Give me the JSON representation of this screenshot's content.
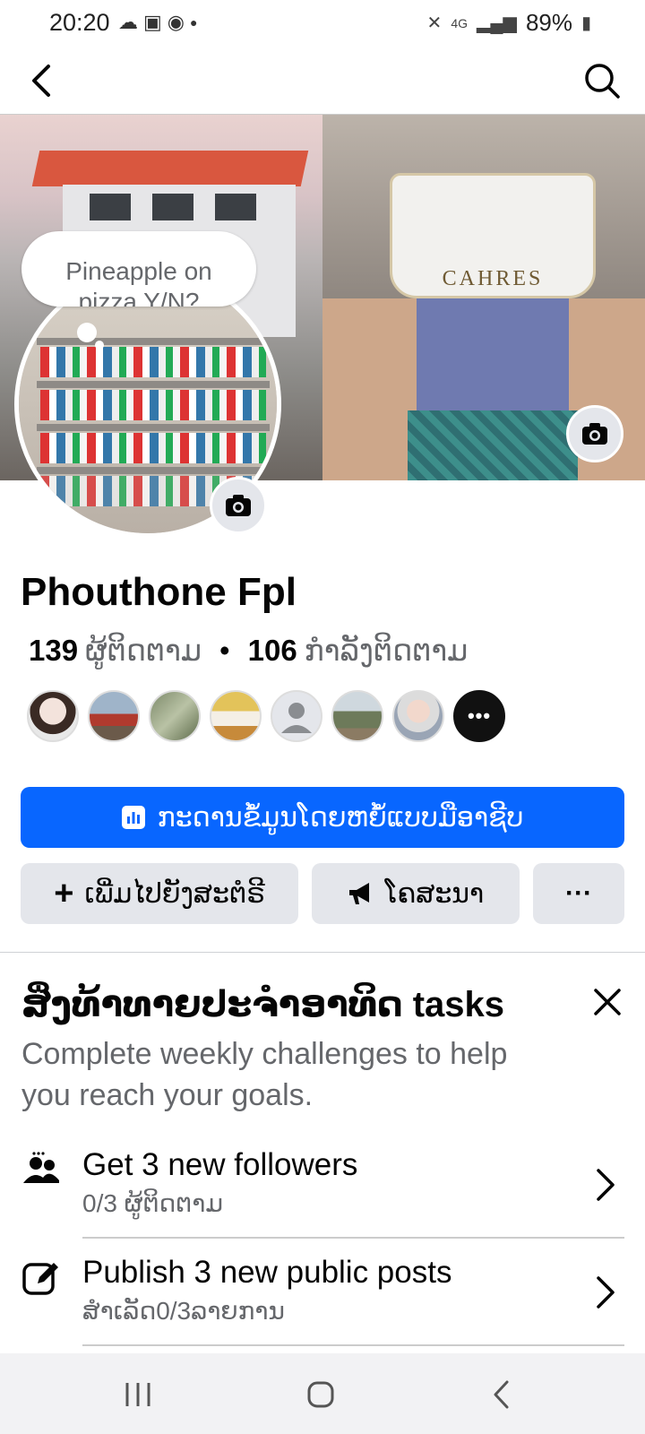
{
  "status_bar": {
    "time": "20:20",
    "notification_icons": [
      "cloud-icon",
      "photos-icon",
      "messenger-icon",
      "dot-icon"
    ],
    "system_icons": [
      "mute-icon",
      "4g-icon",
      "signal-icon"
    ],
    "battery": "89%"
  },
  "cover": {
    "bag_label": "CAHRES"
  },
  "note": {
    "text": "Pineapple on pizza Y/N?"
  },
  "profile": {
    "name": "Phouthone Fpl",
    "followers_count": "139",
    "followers_label": "ຜູ້ຕິດຕາມ",
    "following_count": "106",
    "following_label": "ກຳລັງຕິດຕາມ",
    "separator": "•"
  },
  "friends_more": "•••",
  "buttons": {
    "dashboard_label": "ກະດານຂໍ້ມູນໂດຍຫຍໍ້ແບບມືອາຊີບ",
    "add_story_label": "ເພີ່ມໄປຍັງສະຕໍຣີ",
    "add_story_glyph": "+",
    "promote_label": "ໂຄສະນາ",
    "more_label": "···"
  },
  "tasks": {
    "title": "ສິ່ງທ້າທາຍປະຈຳອາທິດ tasks",
    "description": "Complete weekly challenges to help you reach your goals.",
    "items": [
      {
        "title": "Get 3 new followers",
        "subtitle": "0/3 ຜູ້ຕິດຕາມ",
        "icon": "people-icon"
      },
      {
        "title": "Publish 3 new public posts",
        "subtitle": "ສຳເລັດ0/3ລາຍການ",
        "icon": "compose-icon"
      }
    ]
  },
  "colors": {
    "accent": "#0866ff",
    "secondary_button": "#e4e6eb",
    "muted_text": "#65676b"
  }
}
